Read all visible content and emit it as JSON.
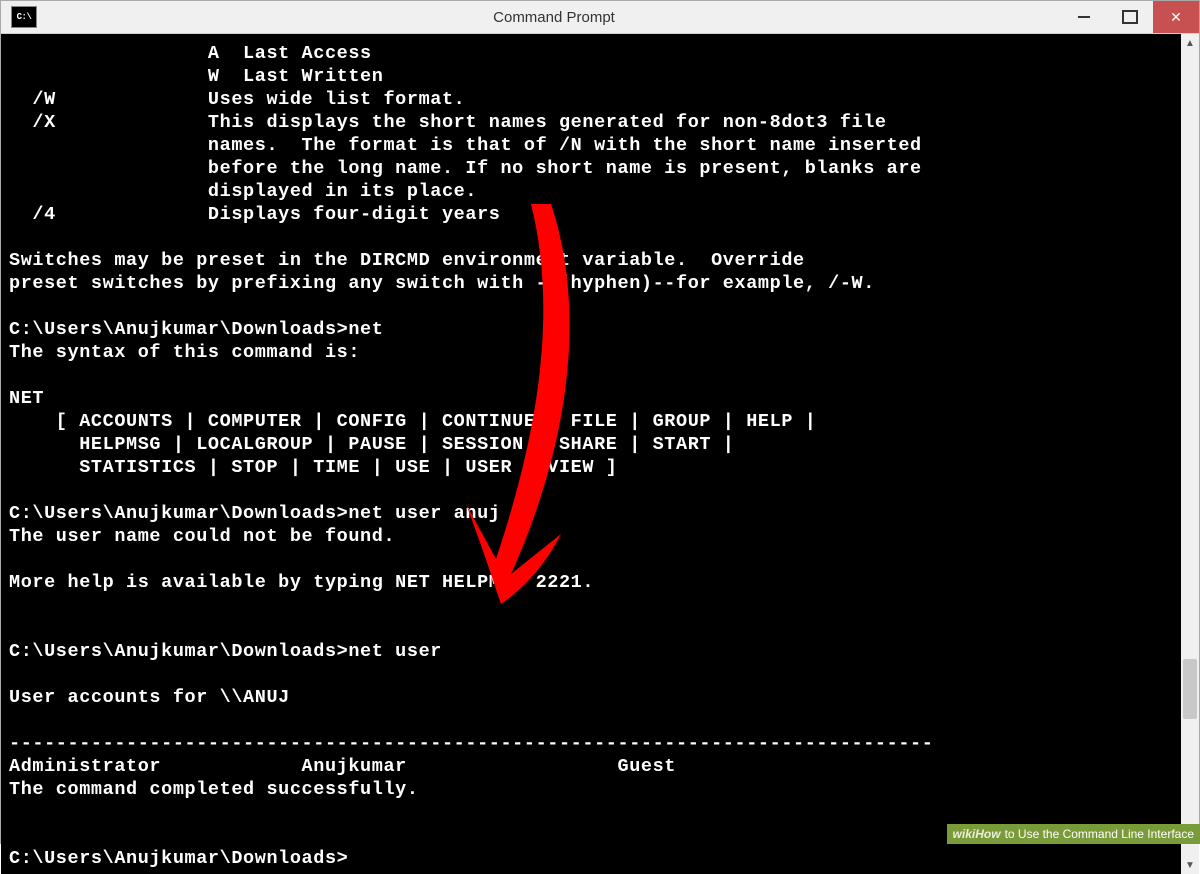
{
  "window": {
    "title": "Command Prompt",
    "icon_label": "C:\\"
  },
  "terminal": {
    "lines": [
      "                 A  Last Access",
      "                 W  Last Written",
      "  /W             Uses wide list format.",
      "  /X             This displays the short names generated for non-8dot3 file",
      "                 names.  The format is that of /N with the short name inserted",
      "                 before the long name. If no short name is present, blanks are",
      "                 displayed in its place.",
      "  /4             Displays four-digit years",
      "",
      "Switches may be preset in the DIRCMD environment variable.  Override",
      "preset switches by prefixing any switch with - (hyphen)--for example, /-W.",
      "",
      "C:\\Users\\Anujkumar\\Downloads>net",
      "The syntax of this command is:",
      "",
      "NET",
      "    [ ACCOUNTS | COMPUTER | CONFIG | CONTINUE | FILE | GROUP | HELP |",
      "      HELPMSG | LOCALGROUP | PAUSE | SESSION | SHARE | START |",
      "      STATISTICS | STOP | TIME | USE | USER | VIEW ]",
      "",
      "C:\\Users\\Anujkumar\\Downloads>net user anuj",
      "The user name could not be found.",
      "",
      "More help is available by typing NET HELPMSG 2221.",
      "",
      "",
      "C:\\Users\\Anujkumar\\Downloads>net user",
      "",
      "User accounts for \\\\ANUJ",
      "",
      "-------------------------------------------------------------------------------",
      "Administrator            Anujkumar                  Guest",
      "The command completed successfully.",
      "",
      "",
      "C:\\Users\\Anujkumar\\Downloads>"
    ]
  },
  "scrollbar": {
    "thumb_top_pct": 85
  },
  "annotation": {
    "arrow_color": "#ff0000"
  },
  "footer": {
    "brand": "wikiHow",
    "caption": " to Use the Command Line Interface"
  }
}
